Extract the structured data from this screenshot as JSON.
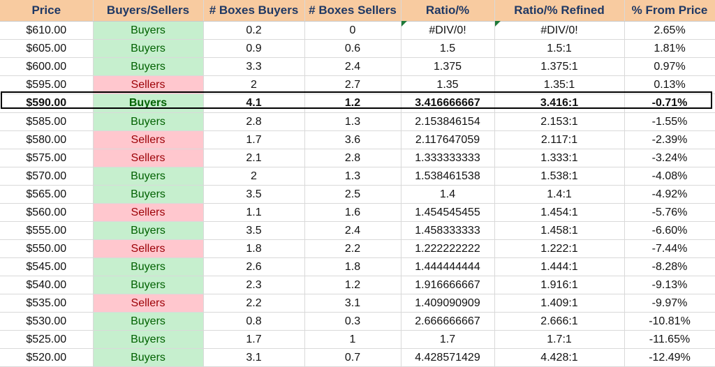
{
  "headers": [
    "Price",
    "Buyers/Sellers",
    "# Boxes Buyers",
    "# Boxes Sellers",
    "Ratio/%",
    "Ratio/% Refined",
    "% From Price"
  ],
  "highlight_row": 4,
  "colors": {
    "header_bg": "#f8cba0",
    "header_text": "#1f3864",
    "buyers_bg": "#c6efce",
    "buyers_text": "#006100",
    "sellers_bg": "#ffc7ce",
    "sellers_text": "#9c0006"
  },
  "rows": [
    [
      "$610.00",
      "Buyers",
      "0.2",
      "0",
      "#DIV/0!",
      "#DIV/0!",
      "2.65%"
    ],
    [
      "$605.00",
      "Buyers",
      "0.9",
      "0.6",
      "1.5",
      "1.5:1",
      "1.81%"
    ],
    [
      "$600.00",
      "Buyers",
      "3.3",
      "2.4",
      "1.375",
      "1.375:1",
      "0.97%"
    ],
    [
      "$595.00",
      "Sellers",
      "2",
      "2.7",
      "1.35",
      "1.35:1",
      "0.13%"
    ],
    [
      "$590.00",
      "Buyers",
      "4.1",
      "1.2",
      "3.416666667",
      "3.416:1",
      "-0.71%"
    ],
    [
      "$585.00",
      "Buyers",
      "2.8",
      "1.3",
      "2.153846154",
      "2.153:1",
      "-1.55%"
    ],
    [
      "$580.00",
      "Sellers",
      "1.7",
      "3.6",
      "2.117647059",
      "2.117:1",
      "-2.39%"
    ],
    [
      "$575.00",
      "Sellers",
      "2.1",
      "2.8",
      "1.333333333",
      "1.333:1",
      "-3.24%"
    ],
    [
      "$570.00",
      "Buyers",
      "2",
      "1.3",
      "1.538461538",
      "1.538:1",
      "-4.08%"
    ],
    [
      "$565.00",
      "Buyers",
      "3.5",
      "2.5",
      "1.4",
      "1.4:1",
      "-4.92%"
    ],
    [
      "$560.00",
      "Sellers",
      "1.1",
      "1.6",
      "1.454545455",
      "1.454:1",
      "-5.76%"
    ],
    [
      "$555.00",
      "Buyers",
      "3.5",
      "2.4",
      "1.458333333",
      "1.458:1",
      "-6.60%"
    ],
    [
      "$550.00",
      "Sellers",
      "1.8",
      "2.2",
      "1.222222222",
      "1.222:1",
      "-7.44%"
    ],
    [
      "$545.00",
      "Buyers",
      "2.6",
      "1.8",
      "1.444444444",
      "1.444:1",
      "-8.28%"
    ],
    [
      "$540.00",
      "Buyers",
      "2.3",
      "1.2",
      "1.916666667",
      "1.916:1",
      "-9.13%"
    ],
    [
      "$535.00",
      "Sellers",
      "2.2",
      "3.1",
      "1.409090909",
      "1.409:1",
      "-9.97%"
    ],
    [
      "$530.00",
      "Buyers",
      "0.8",
      "0.3",
      "2.666666667",
      "2.666:1",
      "-10.81%"
    ],
    [
      "$525.00",
      "Buyers",
      "1.7",
      "1",
      "1.7",
      "1.7:1",
      "-11.65%"
    ],
    [
      "$520.00",
      "Buyers",
      "3.1",
      "0.7",
      "4.428571429",
      "4.428:1",
      "-12.49%"
    ]
  ]
}
